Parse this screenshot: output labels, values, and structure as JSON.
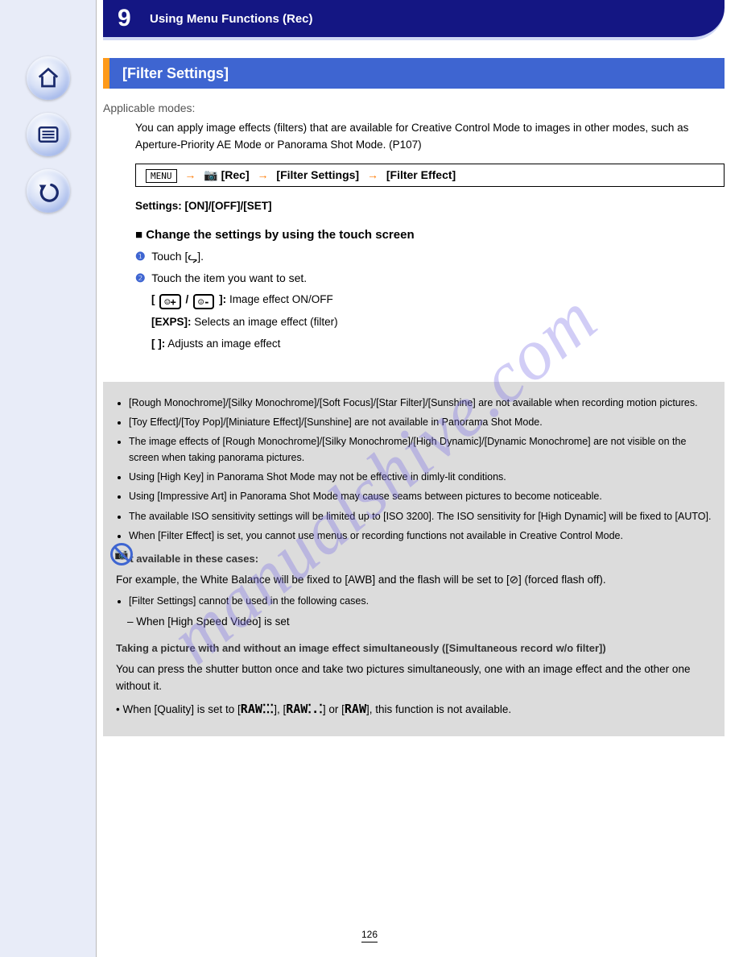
{
  "nav": {
    "home": "home-icon",
    "menu": "menu-icon",
    "back": "back-icon"
  },
  "hero": {
    "number": "9",
    "title": "Using Menu Functions (Rec)"
  },
  "section": {
    "title": "[Filter Settings]"
  },
  "modes": {
    "label": "Applicable modes:",
    "value": ""
  },
  "menu_path": {
    "root": "MENU",
    "step1": "[Rec]",
    "step2": "[Filter Settings]",
    "step3": "[Filter Effect]"
  },
  "settings_line": "Settings: [ON]/[OFF]/[SET]",
  "intro": "You can apply image effects (filters) that are available for Creative Control Mode to images in other modes, such as Aperture-Priority AE Mode or Panorama Shot Mode. (P107)",
  "sub1": {
    "head": "■ Change the settings by using the touch screen",
    "s1_pre": "Touch [",
    "s1_glyph": "ᖤ",
    "s1_post": "].",
    "s2": "Touch the item you want to set.",
    "opt1_label": "[   ]:",
    "opt1_on_glyph": "☺+",
    "opt1_off_glyph": "☺-",
    "opt1_text": "Image effect ON/OFF",
    "opt2_label": "[EXPS]:",
    "opt2_text": "Selects an image effect (filter)",
    "opt3_label": "[   ]:",
    "opt3_text": "Adjusts an image effect"
  },
  "greybox": {
    "items_top": [
      "[Filter Settings] cannot be used in the following cases.",
      "[Rough Monochrome]/[Silky Monochrome]/[Soft Focus]/[Star Filter]/[Sunshine] are not available when recording motion pictures.",
      "[Toy Effect]/[Toy Pop]/[Miniature Effect]/[Sunshine] are not available in Panorama Shot Mode.",
      "The image effects of [Rough Monochrome]/[Silky Monochrome]/[High Dynamic]/[Dynamic Monochrome] are not visible on the screen when taking panorama pictures.",
      "Using [High Key] in Panorama Shot Mode may not be effective in dimly-lit conditions.",
      "Using [Impressive Art] in Panorama Shot Mode may cause seams between pictures to become noticeable.",
      "The available ISO sensitivity settings will be limited up to [ISO 3200]. The ISO sensitivity for [High Dynamic] will be fixed to [AUTO].",
      "When [Filter Effect] is set, you cannot use menus or recording functions not available in Creative Control Mode."
    ],
    "sub_unavailable": "– When [High Speed Video] is set",
    "section2_head": "Not available in these cases:",
    "section2_body_pre": "For example, the White Balance will be fixed to [AWB] and the flash will be set to [",
    "section2_glyph": "⊘",
    "section2_body_post": "] (forced flash off).",
    "taking_head": "Taking a picture with and without an image effect simultaneously ([Simultaneous record w/o filter])",
    "taking_body": "You can press the shutter button once and take two pictures simultaneously, one with an image effect and the other one without it.",
    "raw_line_pre": "• When [Quality] is set to [",
    "raw1": "RAW⁚⁚⁚",
    "raw_mid1": "], [",
    "raw2": "RAW⁚.⁚",
    "raw_mid2": "] or [",
    "raw3": "RAW",
    "raw_line_post": "], this function is not available."
  },
  "page_number": "126",
  "watermark": "manualshive.com"
}
